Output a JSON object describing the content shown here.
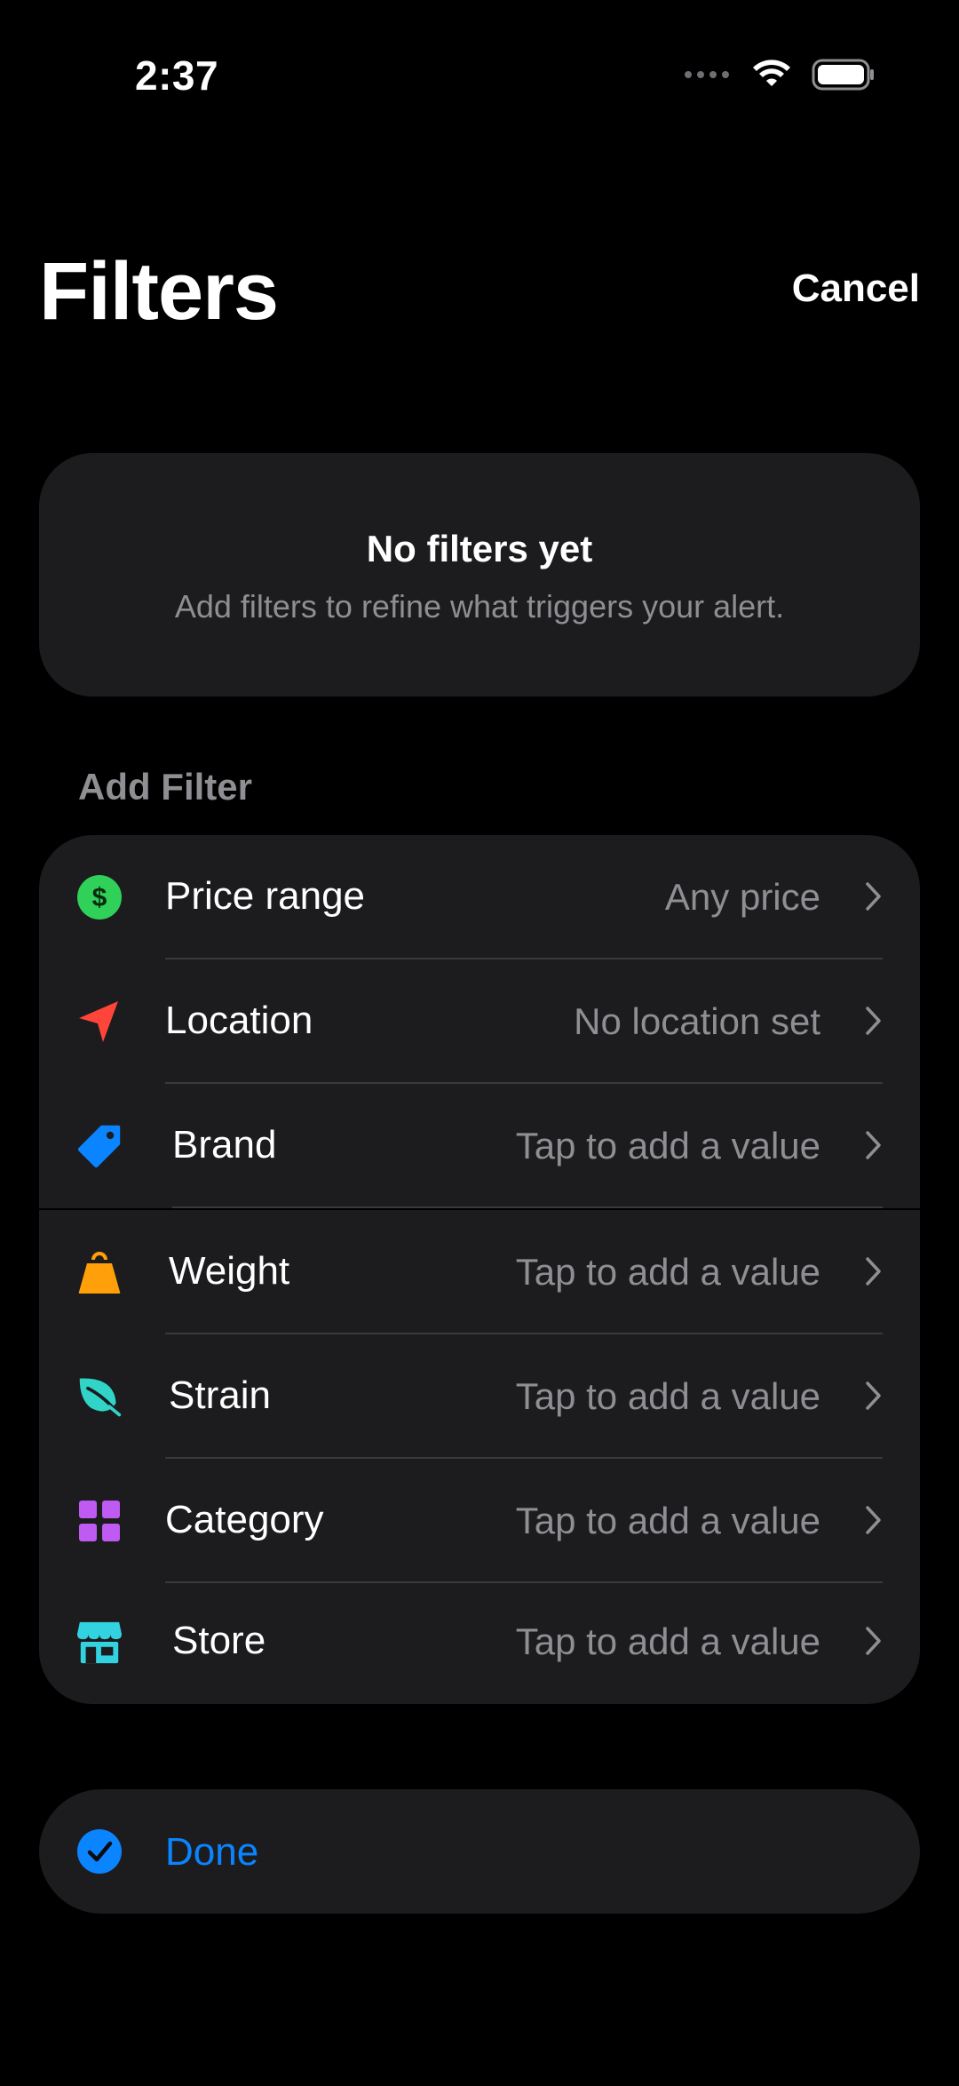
{
  "status_bar": {
    "time": "2:37"
  },
  "header": {
    "title": "Filters",
    "cancel_label": "Cancel"
  },
  "empty_state": {
    "title": "No filters yet",
    "subtitle": "Add filters to refine what triggers your alert."
  },
  "section": {
    "title": "Add Filter"
  },
  "filters": [
    {
      "label": "Price range",
      "value": "Any price",
      "icon": "dollar-circle-icon",
      "color": "#30d158"
    },
    {
      "label": "Location",
      "value": "No location set",
      "icon": "location-arrow-icon",
      "color": "#ff453a"
    },
    {
      "label": "Brand",
      "value": "Tap to add a value",
      "icon": "tag-icon",
      "color": "#0a84ff"
    },
    {
      "label": "Weight",
      "value": "Tap to add a value",
      "icon": "weight-icon",
      "color": "#ff9f0a"
    },
    {
      "label": "Strain",
      "value": "Tap to add a value",
      "icon": "leaf-icon",
      "color": "#30d5c8"
    },
    {
      "label": "Category",
      "value": "Tap to add a value",
      "icon": "grid-icon",
      "color": "#bf5af2"
    },
    {
      "label": "Store",
      "value": "Tap to add a value",
      "icon": "store-icon",
      "color": "#32d2e0"
    }
  ],
  "done": {
    "label": "Done",
    "icon": "checkmark-circle-icon",
    "color": "#0a84ff"
  }
}
